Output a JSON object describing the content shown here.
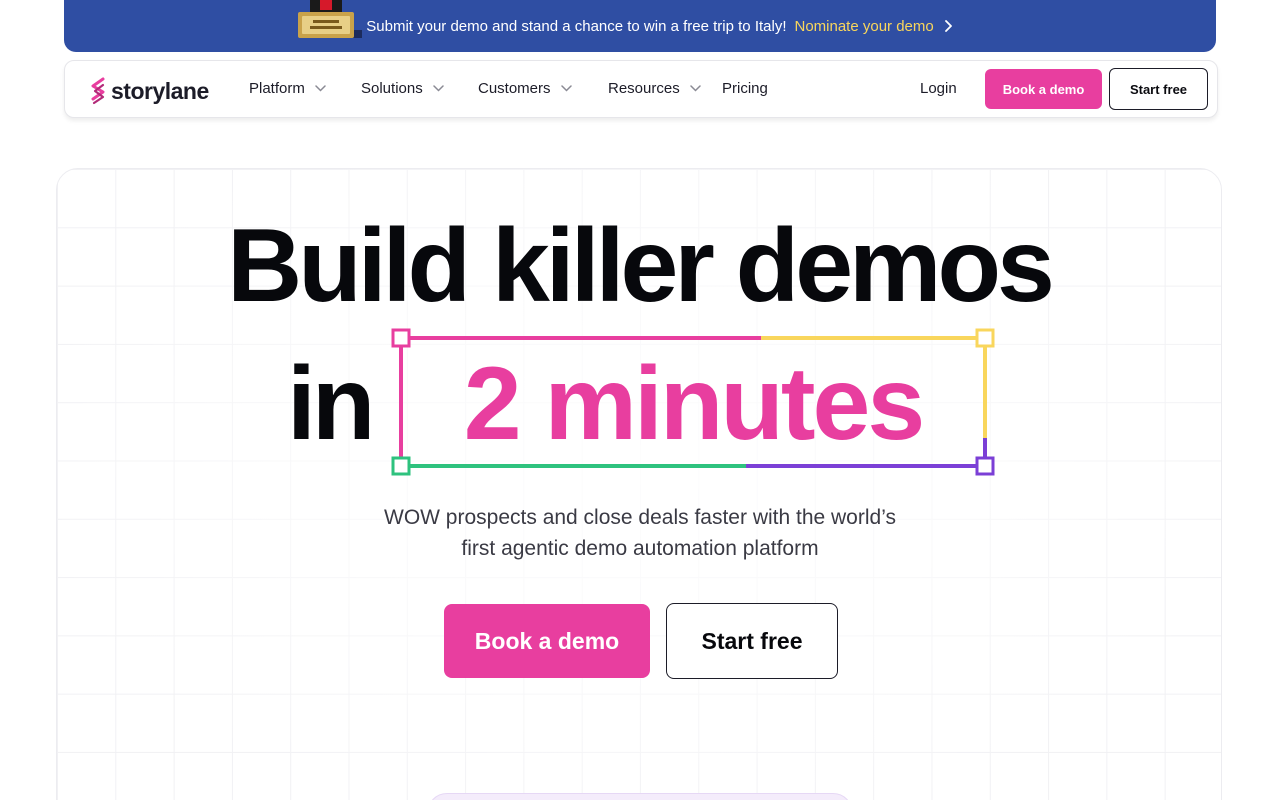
{
  "banner": {
    "text": "Submit your demo and stand a chance to win a free trip to Italy!",
    "link_label": "Nominate your demo",
    "icons": [
      "trophy-icon",
      "chevron-right-icon"
    ]
  },
  "nav": {
    "brand": "storylane",
    "items": [
      {
        "label": "Platform",
        "has_dropdown": true
      },
      {
        "label": "Solutions",
        "has_dropdown": true
      },
      {
        "label": "Customers",
        "has_dropdown": true
      },
      {
        "label": "Resources",
        "has_dropdown": true
      },
      {
        "label": "Pricing",
        "has_dropdown": false
      }
    ],
    "login": "Login",
    "book_demo": "Book a demo",
    "start_free": "Start free"
  },
  "hero": {
    "headline_line1": "Build killer demos",
    "headline_in": "in",
    "headline_highlight": "2 minutes",
    "subtitle_line1": "WOW prospects and close deals faster with the world’s",
    "subtitle_line2": "first agentic demo automation platform",
    "cta_primary": "Book a demo",
    "cta_secondary": "Start free"
  },
  "colors": {
    "banner_bg": "#2f4ea3",
    "banner_link": "#f9d65c",
    "brand_pink": "#e83e9f",
    "highlight_yellow": "#f9d65c",
    "highlight_green": "#2ec27e",
    "highlight_purple": "#7b3fd6",
    "text_dark": "#07080c"
  }
}
